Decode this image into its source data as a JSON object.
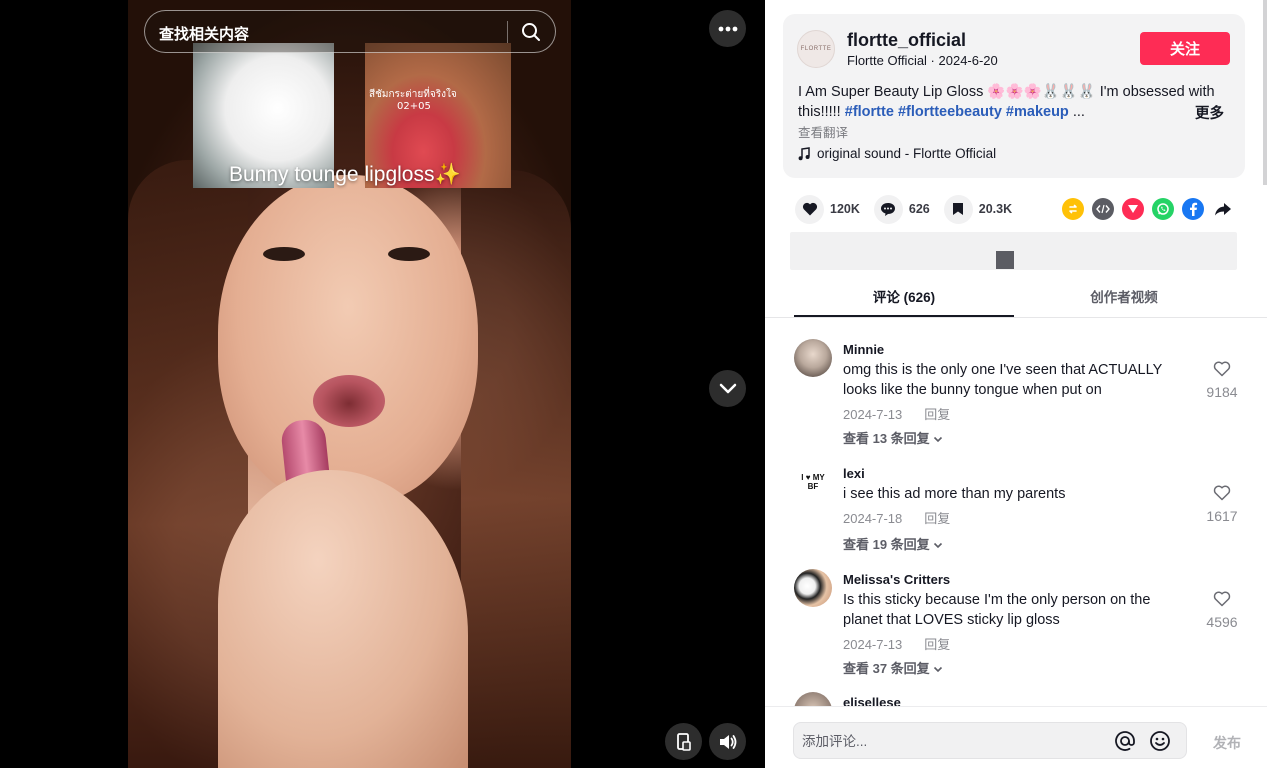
{
  "search": {
    "placeholder": "查找相关内容"
  },
  "video": {
    "overlay_caption": "Bunny tounge lipgloss✨",
    "thai_text_line1": "สีชัมกระต่ายที่จริงใจ",
    "thai_text_line2": "02+05"
  },
  "author": {
    "avatar_text": "FLORTTE",
    "username": "flortte_official",
    "meta": "Flortte Official · 2024-6-20",
    "follow_label": "关注",
    "description": "I Am Super Beauty Lip Gloss 🌸🌸🌸🐰🐰🐰 I'm obsessed with this!!!!!",
    "hashtags": [
      "#flortte",
      "#flortteebeauty",
      "#makeup"
    ],
    "ellipsis": "...",
    "more_label": "更多",
    "translate_label": "查看翻译",
    "sound": "original sound - Flortte Official"
  },
  "stats": {
    "likes": "120K",
    "comments": "626",
    "saves": "20.3K"
  },
  "share_icons": [
    "repost-icon",
    "embed-icon",
    "send-icon",
    "whatsapp-icon",
    "facebook-icon",
    "share-arrow-icon"
  ],
  "colors": {
    "accent": "#fe2c55",
    "hashtag": "#2b5db9",
    "whatsapp": "#25d366",
    "facebook": "#1877f2",
    "repost": "#ffc107",
    "send": "#fe2c55"
  },
  "tabs": {
    "comments": "评论 (626)",
    "creator_videos": "创作者视频"
  },
  "comments": [
    {
      "user": "Minnie",
      "text": "omg this is the only one I've seen that ACTUALLY looks like the bunny tongue when put on",
      "date": "2024-7-13",
      "reply": "回复",
      "replies": "查看 13 条回复",
      "likes": "9184"
    },
    {
      "user": "lexi",
      "text": "i see this ad more than my parents",
      "date": "2024-7-18",
      "reply": "回复",
      "replies": "查看 19 条回复",
      "likes": "1617",
      "avatar_text": "I ♥ MY BF"
    },
    {
      "user": "Melissa's Critters",
      "text": "Is this sticky because I'm the only person on the planet that LOVES sticky lip gloss",
      "date": "2024-7-13",
      "reply": "回复",
      "replies": "查看 37 条回复",
      "likes": "4596"
    },
    {
      "user": "elisellese"
    }
  ],
  "comment_box": {
    "placeholder": "添加评论...",
    "post_label": "发布"
  }
}
